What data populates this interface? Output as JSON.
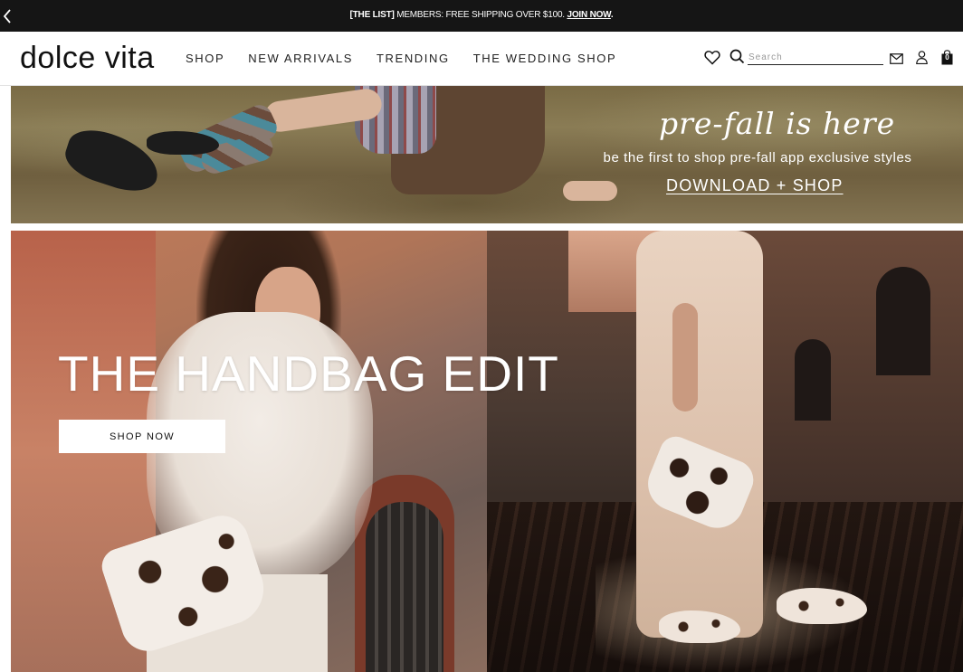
{
  "announcement": {
    "lead": "[THE LIST]",
    "text": " MEMBERS: FREE SHIPPING OVER $100. ",
    "link": "JOIN NOW",
    "tail": "."
  },
  "header": {
    "logo": "dolce vita",
    "nav": [
      "SHOP",
      "NEW ARRIVALS",
      "TRENDING",
      "THE WEDDING SHOP"
    ],
    "search_placeholder": "Search",
    "bag_count": "0"
  },
  "hero_prefall": {
    "title": "pre-fall is here",
    "subtitle": "be the first to shop pre-fall app exclusive styles",
    "cta": "DOWNLOAD + SHOP"
  },
  "hero_handbag": {
    "title": "THE HANDBAG EDIT",
    "cta": "SHOP NOW"
  },
  "icons": {
    "back": "chevron-left-icon",
    "wishlist": "heart-icon",
    "search": "search-icon",
    "mail": "mail-icon",
    "account": "user-icon",
    "bag": "shopping-bag-icon"
  },
  "colors": {
    "announcement_bg": "#151515",
    "text_primary": "#111111",
    "background": "#ffffff"
  }
}
